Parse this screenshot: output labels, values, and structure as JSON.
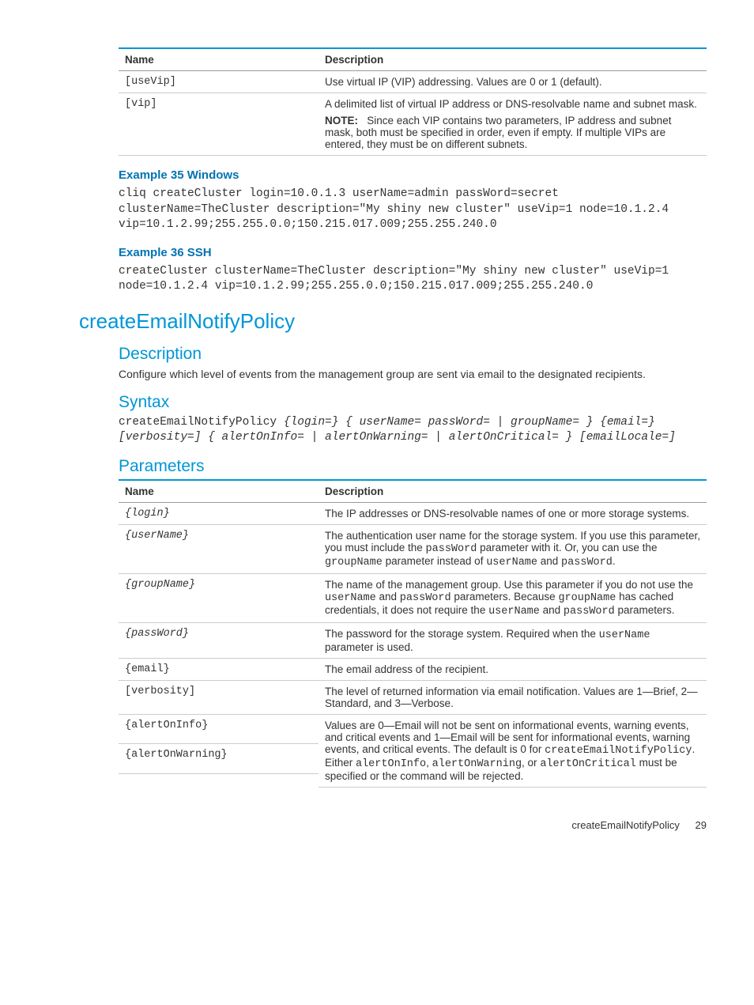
{
  "table1": {
    "headers": [
      "Name",
      "Description"
    ],
    "rows": [
      {
        "name": "[useVip]",
        "desc": "Use virtual IP (VIP) addressing. Values are 0 or 1 (default)."
      },
      {
        "name": "[vip]",
        "desc1": "A delimited list of virtual IP address or DNS-resolvable name and subnet mask.",
        "note_label": "NOTE:",
        "note_text": "Since each VIP contains two parameters, IP address and subnet mask, both must be specified in order, even if empty. If multiple VIPs are entered, they must be on different subnets."
      }
    ]
  },
  "example35": {
    "title": "Example 35 Windows",
    "code": "cliq createCluster login=10.0.1.3 userName=admin passWord=secret clusterName=TheCluster description=\"My shiny new cluster\" useVip=1 node=10.1.2.4 vip=10.1.2.99;255.255.0.0;150.215.017.009;255.255.240.0"
  },
  "example36": {
    "title": "Example 36 SSH",
    "code": "createCluster clusterName=TheCluster description=\"My shiny new cluster\" useVip=1 node=10.1.2.4 vip=10.1.2.99;255.255.0.0;150.215.017.009;255.255.240.0"
  },
  "command": {
    "title": "createEmailNotifyPolicy",
    "desc_heading": "Description",
    "desc_text": "Configure which level of events from the management group are sent via email to the designated recipients.",
    "syntax_heading": "Syntax",
    "syntax_code": "createEmailNotifyPolicy {login=} { userName= passWord= | groupName= } {email=} [verbosity=] { alertOnInfo= | alertOnWarning= | alertOnCritical= } [emailLocale=]",
    "params_heading": "Parameters"
  },
  "table2": {
    "headers": [
      "Name",
      "Description"
    ],
    "rows": {
      "login": {
        "name": "{login}",
        "desc": "The IP addresses or DNS-resolvable names of one or more storage systems."
      },
      "userName": {
        "name": "{userName}",
        "d_pre": "The authentication user name for the storage system. If you use this parameter, you must include the ",
        "c1": "passWord",
        "d_mid1": " parameter with it. Or, you can use the ",
        "c2": "groupName",
        "d_mid2": " parameter instead of ",
        "c3": "userName",
        "d_mid3": " and ",
        "c4": "passWord",
        "d_end": "."
      },
      "groupName": {
        "name": "{groupName}",
        "d_pre": "The name of the management group. Use this parameter if you do not use the ",
        "c1": "userName",
        "d_mid1": " and ",
        "c2": "passWord",
        "d_mid2": " parameters. Because ",
        "c3": "groupName",
        "d_mid3": " has cached credentials, it does not require the ",
        "c4": "userName",
        "d_mid4": " and ",
        "c5": "passWord",
        "d_end": " parameters."
      },
      "passWord": {
        "name": "{passWord}",
        "d_pre": "The password for the storage system. Required when the ",
        "c1": "userName",
        "d_end": " parameter is used."
      },
      "email": {
        "name": "{email}",
        "desc": "The email address of the recipient."
      },
      "verbosity": {
        "name": "[verbosity]",
        "desc": "The level of returned information via email notification. Values are 1—Brief, 2—Standard, and 3—Verbose."
      },
      "alertGroup": {
        "n1": "{alertOnInfo}",
        "n2": "{alertOnWarning}",
        "d_pre": "Values are 0—Email will not be sent on informational events, warning events, and critical events and 1—Email will be sent for informational events, warning events, and critical events. The default is 0 for ",
        "c1": "createEmailNotifyPolicy",
        "d_mid1": ". Either ",
        "c2": "alertOnInfo",
        "d_mid2": ", ",
        "c3": "alertOnWarning",
        "d_mid3": ", or ",
        "c4": "alertOnCritical",
        "d_end": " must be specified or the command will be rejected."
      }
    }
  },
  "footer": {
    "label": "createEmailNotifyPolicy",
    "page": "29"
  }
}
